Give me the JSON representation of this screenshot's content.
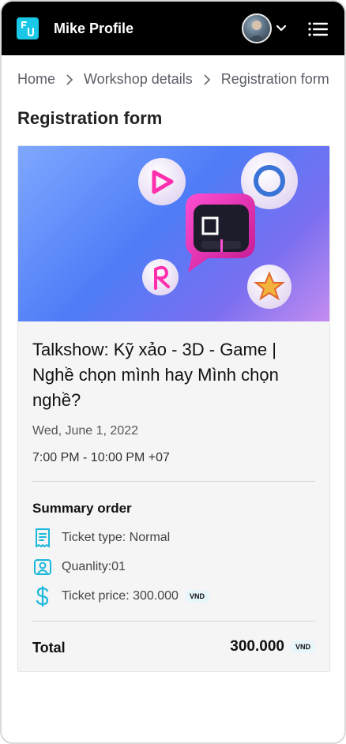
{
  "header": {
    "title": "Mike Profile",
    "logo_icon": "fu-logo-icon",
    "accent": "#19c7e6"
  },
  "breadcrumb": {
    "items": [
      "Home",
      "Workshop details",
      "Registration form"
    ]
  },
  "page": {
    "title": "Registration form"
  },
  "event": {
    "title": "Talkshow: Kỹ xảo - 3D - Game | Nghề chọn mình hay Mình chọn nghề?",
    "date": "Wed, June 1, 2022",
    "time": "7:00 PM - 10:00 PM +07"
  },
  "summary": {
    "title": "Summary order",
    "ticket_type": "Ticket type: Normal",
    "quantity": "Quanlity:01",
    "ticket_price": "Ticket price: 300.000",
    "currency": "VND"
  },
  "total": {
    "label": "Total",
    "value": "300.000",
    "currency": "VND"
  }
}
